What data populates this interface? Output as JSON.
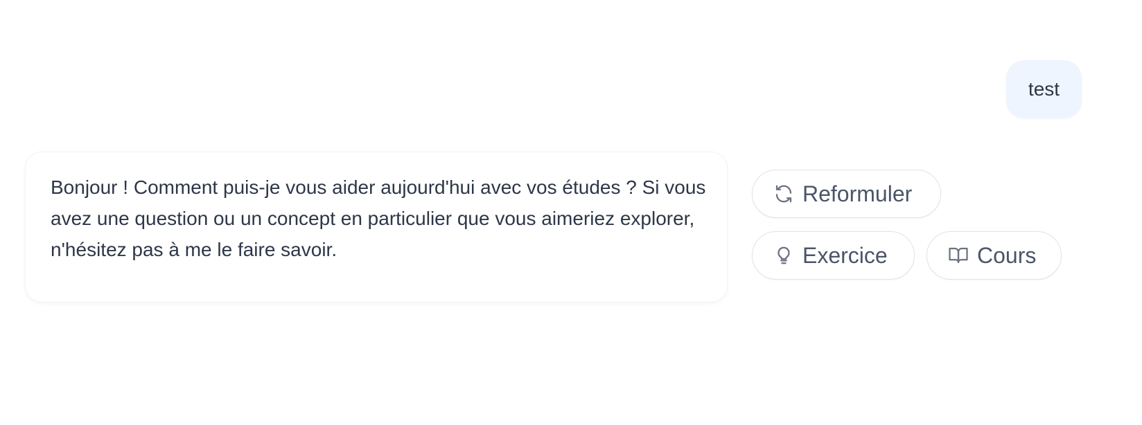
{
  "user_message": {
    "text": "test"
  },
  "assistant_message": {
    "text": "Bonjour ! Comment puis-je vous aider aujourd'hui avec vos études ? Si vous avez une question ou un concept en particulier que vous aimeriez explorer, n'hésitez pas à me le faire savoir."
  },
  "actions": {
    "reformuler": {
      "label": "Reformuler",
      "icon": "refresh-icon"
    },
    "exercice": {
      "label": "Exercice",
      "icon": "lightbulb-icon"
    },
    "cours": {
      "label": "Cours",
      "icon": "book-open-icon"
    }
  },
  "colors": {
    "user_bubble_bg": "#eef5fe",
    "text": "#2d3748",
    "button_border": "#dfe3e8",
    "icon": "#6b7280"
  }
}
